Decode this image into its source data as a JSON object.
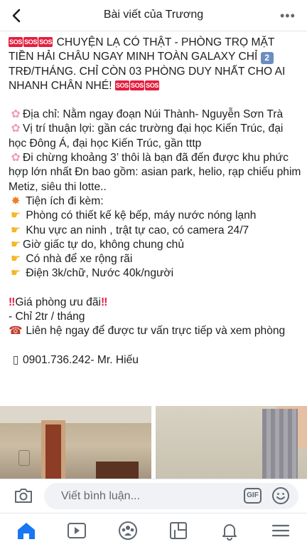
{
  "header": {
    "title": "Bài viết của Trương",
    "back_icon": "chevron-left-icon",
    "more_label": "•••"
  },
  "post": {
    "sos_label": "SOS",
    "headline_part1": "CHUYỆN LẠ CÓ THẬT - PHÒNG TRỌ MẶT TIỀN HẢI CHÂU NGAY MINH TOÀN GALAXY CHỈ",
    "headline_number": "2",
    "headline_part2": "TRĐ/THÁNG. CHỈ CÒN 03 PHÒNG DUY NHẤT CHO AI NHANH CHÂN NHÉ!",
    "address": "Địa chỉ: Nằm ngay đoạn Núi Thành- Nguyễn Sơn Trà",
    "location": "Vị trí thuận lợi: gần các trường đại học Kiến Trúc, đại học Đông Á, đại học Kiến Trúc, gần tttp",
    "nearby": "Đi chừng khoảng 3’ thôi là bạn đã đến được khu phức hợp lớn nhất Đn bao gồm: asian park, helio, rạp chiếu phim Metiz, siêu thi lotte..",
    "amenities_title": "Tiện ích đi kèm:",
    "amenities": [
      "Phòng có thiết kế kệ bếp, máy nước nóng lạnh",
      "Khu vực an ninh , trật tự cao, có camera 24/7",
      "Giờ giấc tự do, không chung chủ",
      "Có nhà để xe rộng rãi",
      "Điện 3k/chữ, Nước 40k/người"
    ],
    "price_title": "Giá phòng ưu đãi",
    "price_value": "- Chỉ 2tr / tháng",
    "contact": "Liên hệ ngay để được tư vấn trực tiếp và xem phòng",
    "phone": "0901.736.242- Mr. Hiếu"
  },
  "photos": [
    {
      "label": "room-photo-door"
    },
    {
      "label": "room-photo-window"
    }
  ],
  "comment_bar": {
    "placeholder": "Viết bình luận...",
    "gif_label": "GIF"
  },
  "tabbar": {
    "items": [
      "home-icon",
      "video-icon",
      "groups-icon",
      "marketplace-icon",
      "notifications-icon",
      "menu-icon"
    ],
    "active_color": "#1877f2",
    "inactive_color": "#606770"
  }
}
